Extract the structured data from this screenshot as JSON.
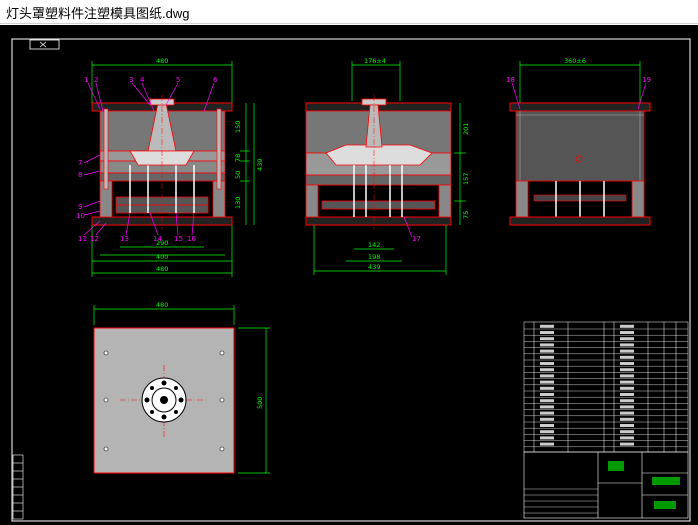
{
  "window": {
    "title": "灯头罩塑料件注塑模具图纸.dwg"
  },
  "colors": {
    "background": "#000000",
    "frame": "#ffffff",
    "outline": "#ff0000",
    "dimension": "#00ff00",
    "leader": "#ff00ff",
    "steel": "#aaaaaa"
  },
  "drawing": {
    "front_view": {
      "top_width": "480",
      "bottom_widths": [
        "290",
        "400",
        "480"
      ],
      "heights": [
        "150",
        "78",
        "50",
        "130"
      ],
      "total_height": "439",
      "part_numbers": [
        "1",
        "2",
        "3",
        "4",
        "5",
        "6",
        "7",
        "8",
        "9",
        "10",
        "11",
        "12",
        "13",
        "14",
        "15",
        "16"
      ]
    },
    "side_view": {
      "top_width": "176±4",
      "bottom_widths": [
        "142",
        "198",
        "439"
      ],
      "heights": [
        "201",
        "157",
        "75"
      ],
      "part_numbers": [
        "17"
      ]
    },
    "right_view": {
      "top_width": "360±6",
      "part_numbers": [
        "18",
        "19"
      ]
    },
    "plan_view": {
      "width": "480",
      "height": "500"
    }
  }
}
